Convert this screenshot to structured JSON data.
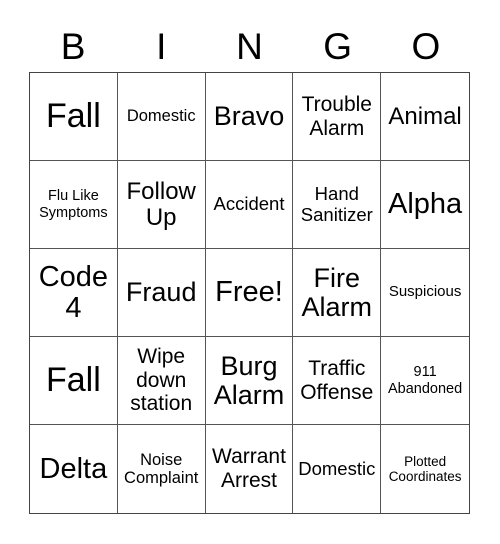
{
  "header": {
    "letters": [
      "B",
      "I",
      "N",
      "G",
      "O"
    ]
  },
  "cells": [
    "Fall",
    "Domestic",
    "Bravo",
    "Trouble Alarm",
    "Animal",
    "Flu Like Symptoms",
    "Follow Up",
    "Accident",
    "Hand Sanitizer",
    "Alpha",
    "Code 4",
    "Fraud",
    "Free!",
    "Fire Alarm",
    "Suspicious",
    "Fall",
    "Wipe down station",
    "Burg Alarm",
    "Traffic Offense",
    "911 Abandoned",
    "Delta",
    "Noise Complaint",
    "Warrant Arrest",
    "Domestic",
    "Plotted Coordinates"
  ]
}
